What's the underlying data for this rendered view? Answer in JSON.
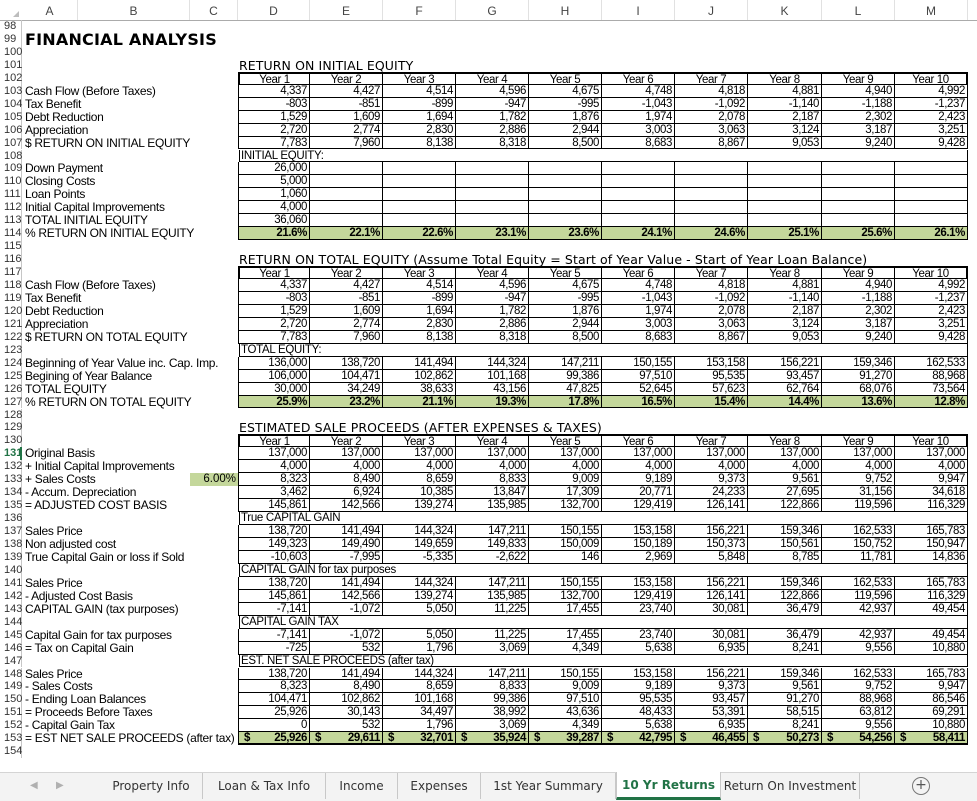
{
  "columns": [
    "A",
    "B",
    "C",
    "D",
    "E",
    "F",
    "G",
    "H",
    "I",
    "J",
    "K",
    "L",
    "M"
  ],
  "title": "FINANCIAL ANALYSIS",
  "years": [
    "Year 1",
    "Year 2",
    "Year 3",
    "Year 4",
    "Year 5",
    "Year 6",
    "Year 7",
    "Year 8",
    "Year 9",
    "Year 10"
  ],
  "roie": {
    "title": "RETURN ON INITIAL EQUITY",
    "rows": [
      {
        "label": "Cash Flow (Before Taxes)",
        "values": [
          "4,337",
          "4,427",
          "4,514",
          "4,596",
          "4,675",
          "4,748",
          "4,818",
          "4,881",
          "4,940",
          "4,992"
        ]
      },
      {
        "label": "Tax Benefit",
        "values": [
          "-803",
          "-851",
          "-899",
          "-947",
          "-995",
          "-1,043",
          "-1,092",
          "-1,140",
          "-1,188",
          "-1,237"
        ]
      },
      {
        "label": "Debt Reduction",
        "values": [
          "1,529",
          "1,609",
          "1,694",
          "1,782",
          "1,876",
          "1,974",
          "2,078",
          "2,187",
          "2,302",
          "2,423"
        ]
      },
      {
        "label": "Appreciation",
        "values": [
          "2,720",
          "2,774",
          "2,830",
          "2,886",
          "2,944",
          "3,003",
          "3,063",
          "3,124",
          "3,187",
          "3,251"
        ]
      },
      {
        "label": "$ RETURN ON INITIAL EQUITY",
        "values": [
          "7,783",
          "7,960",
          "8,138",
          "8,318",
          "8,500",
          "8,683",
          "8,867",
          "9,053",
          "9,240",
          "9,428"
        ]
      }
    ],
    "subheading": "INITIAL EQUITY:",
    "equity_rows": [
      {
        "label": "Down Payment",
        "value": "26,000"
      },
      {
        "label": "Closing Costs",
        "value": "5,000"
      },
      {
        "label": "Loan Points",
        "value": "1,060"
      },
      {
        "label": "Initial Capital Improvements",
        "value": "4,000"
      },
      {
        "label": "TOTAL INITIAL EQUITY",
        "value": "36,060"
      }
    ],
    "pct_row": {
      "label": "% RETURN ON INITIAL EQUITY",
      "values": [
        "21.6%",
        "22.1%",
        "22.6%",
        "23.1%",
        "23.6%",
        "24.1%",
        "24.6%",
        "25.1%",
        "25.6%",
        "26.1%"
      ]
    }
  },
  "rote": {
    "title": "RETURN ON TOTAL EQUITY  (Assume Total Equity = Start of Year Value - Start of Year Loan Balance)",
    "rows": [
      {
        "label": "Cash Flow (Before Taxes)",
        "values": [
          "4,337",
          "4,427",
          "4,514",
          "4,596",
          "4,675",
          "4,748",
          "4,818",
          "4,881",
          "4,940",
          "4,992"
        ]
      },
      {
        "label": "Tax Benefit",
        "values": [
          "-803",
          "-851",
          "-899",
          "-947",
          "-995",
          "-1,043",
          "-1,092",
          "-1,140",
          "-1,188",
          "-1,237"
        ]
      },
      {
        "label": "Debt Reduction",
        "values": [
          "1,529",
          "1,609",
          "1,694",
          "1,782",
          "1,876",
          "1,974",
          "2,078",
          "2,187",
          "2,302",
          "2,423"
        ]
      },
      {
        "label": "Appreciation",
        "values": [
          "2,720",
          "2,774",
          "2,830",
          "2,886",
          "2,944",
          "3,003",
          "3,063",
          "3,124",
          "3,187",
          "3,251"
        ]
      },
      {
        "label": "$ RETURN ON TOTAL EQUITY",
        "values": [
          "7,783",
          "7,960",
          "8,138",
          "8,318",
          "8,500",
          "8,683",
          "8,867",
          "9,053",
          "9,240",
          "9,428"
        ]
      }
    ],
    "subheading": "TOTAL EQUITY:",
    "equity_rows": [
      {
        "label": "Beginning of Year Value inc. Cap. Imp.",
        "values": [
          "136,000",
          "138,720",
          "141,494",
          "144,324",
          "147,211",
          "150,155",
          "153,158",
          "156,221",
          "159,346",
          "162,533"
        ]
      },
      {
        "label": "Begining of Year Balance",
        "values": [
          "106,000",
          "104,471",
          "102,862",
          "101,168",
          "99,386",
          "97,510",
          "95,535",
          "93,457",
          "91,270",
          "88,968"
        ]
      },
      {
        "label": "TOTAL EQUITY",
        "values": [
          "30,000",
          "34,249",
          "38,633",
          "43,156",
          "47,825",
          "52,645",
          "57,623",
          "62,764",
          "68,076",
          "73,564"
        ]
      }
    ],
    "pct_row": {
      "label": "% RETURN ON TOTAL EQUITY",
      "values": [
        "25.9%",
        "23.2%",
        "21.1%",
        "19.3%",
        "17.8%",
        "16.5%",
        "15.4%",
        "14.4%",
        "13.6%",
        "12.8%"
      ]
    }
  },
  "esp": {
    "title": "ESTIMATED SALE PROCEEDS (AFTER EXPENSES & TAXES)",
    "sales_cost_rate": "6.00%",
    "basis_rows": [
      {
        "label": "Original Basis",
        "values": [
          "137,000",
          "137,000",
          "137,000",
          "137,000",
          "137,000",
          "137,000",
          "137,000",
          "137,000",
          "137,000",
          "137,000"
        ]
      },
      {
        "label": "+ Initial Capital Improvements",
        "values": [
          "4,000",
          "4,000",
          "4,000",
          "4,000",
          "4,000",
          "4,000",
          "4,000",
          "4,000",
          "4,000",
          "4,000"
        ]
      },
      {
        "label": "+ Sales Costs",
        "values": [
          "8,323",
          "8,490",
          "8,659",
          "8,833",
          "9,009",
          "9,189",
          "9,373",
          "9,561",
          "9,752",
          "9,947"
        ]
      },
      {
        "label": "- Accum. Depreciation",
        "values": [
          "3,462",
          "6,924",
          "10,385",
          "13,847",
          "17,309",
          "20,771",
          "24,233",
          "27,695",
          "31,156",
          "34,618"
        ]
      },
      {
        "label": "= ADJUSTED COST BASIS",
        "values": [
          "145,861",
          "142,566",
          "139,274",
          "135,985",
          "132,700",
          "129,419",
          "126,141",
          "122,866",
          "119,596",
          "116,329"
        ]
      }
    ],
    "true_gain_heading": "True CAPITAL GAIN",
    "true_gain_rows": [
      {
        "label": "Sales Price",
        "values": [
          "138,720",
          "141,494",
          "144,324",
          "147,211",
          "150,155",
          "153,158",
          "156,221",
          "159,346",
          "162,533",
          "165,783"
        ]
      },
      {
        "label": "Non adjusted cost",
        "values": [
          "149,323",
          "149,490",
          "149,659",
          "149,833",
          "150,009",
          "150,189",
          "150,373",
          "150,561",
          "150,752",
          "150,947"
        ]
      },
      {
        "label": "True Capital Gain or loss if Sold",
        "values": [
          "-10,603",
          "-7,995",
          "-5,335",
          "-2,622",
          "146",
          "2,969",
          "5,848",
          "8,785",
          "11,781",
          "14,836"
        ]
      }
    ],
    "tax_gain_heading": "CAPITAL GAIN for tax purposes",
    "tax_gain_rows": [
      {
        "label": "Sales Price",
        "values": [
          "138,720",
          "141,494",
          "144,324",
          "147,211",
          "150,155",
          "153,158",
          "156,221",
          "159,346",
          "162,533",
          "165,783"
        ]
      },
      {
        "label": "- Adjusted Cost Basis",
        "values": [
          "145,861",
          "142,566",
          "139,274",
          "135,985",
          "132,700",
          "129,419",
          "126,141",
          "122,866",
          "119,596",
          "116,329"
        ]
      },
      {
        "label": "CAPITAL GAIN (tax purposes)",
        "values": [
          "-7,141",
          "-1,072",
          "5,050",
          "11,225",
          "17,455",
          "23,740",
          "30,081",
          "36,479",
          "42,937",
          "49,454"
        ]
      }
    ],
    "cg_tax_heading": "CAPITAL GAIN TAX",
    "cg_tax_rows": [
      {
        "label": "Capital Gain for tax purposes",
        "values": [
          "-7,141",
          "-1,072",
          "5,050",
          "11,225",
          "17,455",
          "23,740",
          "30,081",
          "36,479",
          "42,937",
          "49,454"
        ]
      },
      {
        "label": "= Tax on Capital Gain",
        "values": [
          "-725",
          "532",
          "1,796",
          "3,069",
          "4,349",
          "5,638",
          "6,935",
          "8,241",
          "9,556",
          "10,880"
        ]
      }
    ],
    "net_heading": "EST. NET SALE PROCEEDS (after tax)",
    "net_rows": [
      {
        "label": "Sales Price",
        "values": [
          "138,720",
          "141,494",
          "144,324",
          "147,211",
          "150,155",
          "153,158",
          "156,221",
          "159,346",
          "162,533",
          "165,783"
        ]
      },
      {
        "label": "- Sales Costs",
        "values": [
          "8,323",
          "8,490",
          "8,659",
          "8,833",
          "9,009",
          "9,189",
          "9,373",
          "9,561",
          "9,752",
          "9,947"
        ]
      },
      {
        "label": "- Ending Loan Balances",
        "values": [
          "104,471",
          "102,862",
          "101,168",
          "99,386",
          "97,510",
          "95,535",
          "93,457",
          "91,270",
          "88,968",
          "86,546"
        ]
      },
      {
        "label": "= Proceeds Before Taxes",
        "values": [
          "25,926",
          "30,143",
          "34,497",
          "38,992",
          "43,636",
          "48,433",
          "53,391",
          "58,515",
          "63,812",
          "69,291"
        ]
      },
      {
        "label": "- Capital Gain Tax",
        "values": [
          "0",
          "532",
          "1,796",
          "3,069",
          "4,349",
          "5,638",
          "6,935",
          "8,241",
          "9,556",
          "10,880"
        ]
      }
    ],
    "total_row": {
      "label": "= EST NET SALE PROCEEDS (after tax)",
      "currency": "$",
      "values": [
        "25,926",
        "29,611",
        "32,701",
        "35,924",
        "39,287",
        "42,795",
        "46,455",
        "50,273",
        "54,256",
        "58,411"
      ]
    }
  },
  "selected_row": "131",
  "sheet_tabs": [
    "Property Info",
    "Loan & Tax Info",
    "Income",
    "Expenses",
    "1st Year Summary",
    "10 Yr Returns",
    "Return On Investment"
  ],
  "active_tab": "10 Yr Returns",
  "icons": {
    "prev": "◀",
    "next": "▶",
    "add": "+"
  }
}
